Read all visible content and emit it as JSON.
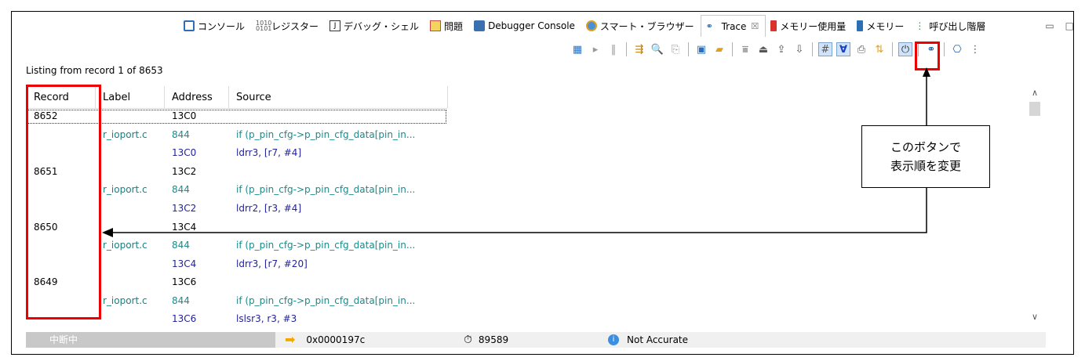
{
  "tabs": [
    {
      "label": "コンソール",
      "icon": "console-icon",
      "active": false
    },
    {
      "label": "レジスター",
      "icon": "register-icon",
      "active": false
    },
    {
      "label": "デバッグ・シェル",
      "icon": "debug-shell-icon",
      "active": false
    },
    {
      "label": "問題",
      "icon": "problems-icon",
      "active": false
    },
    {
      "label": "Debugger Console",
      "icon": "debugger-console-icon",
      "active": false
    },
    {
      "label": "スマート・ブラウザー",
      "icon": "smart-browser-icon",
      "active": false
    },
    {
      "label": "Trace",
      "icon": "trace-icon",
      "active": true,
      "close": "☒"
    },
    {
      "label": "メモリー使用量",
      "icon": "memory-usage-icon",
      "active": false
    },
    {
      "label": "メモリー",
      "icon": "memory-icon",
      "active": false
    },
    {
      "label": "呼び出し階層",
      "icon": "call-hierarchy-icon",
      "active": false
    }
  ],
  "window": {
    "minimize": "▭",
    "maximize": "□"
  },
  "listing_text": "Listing from record 1 of 8653",
  "table": {
    "headers": [
      "Record",
      "Label",
      "Address",
      "Source"
    ],
    "rows": [
      {
        "record": "8652",
        "label": "",
        "address": "13C0",
        "source": ""
      },
      {
        "record": "",
        "label": "r_ioport.c",
        "address": "844",
        "source": "if (p_pin_cfg->p_pin_cfg_data[pin_in..."
      },
      {
        "record": "",
        "label": "",
        "address": "13C0",
        "source": "ldrr3, [r7, #4]"
      },
      {
        "record": "8651",
        "label": "",
        "address": "13C2",
        "source": ""
      },
      {
        "record": "",
        "label": "r_ioport.c",
        "address": "844",
        "source": "if (p_pin_cfg->p_pin_cfg_data[pin_in..."
      },
      {
        "record": "",
        "label": "",
        "address": "13C2",
        "source": "ldrr2, [r3, #4]"
      },
      {
        "record": "8650",
        "label": "",
        "address": "13C4",
        "source": ""
      },
      {
        "record": "",
        "label": "r_ioport.c",
        "address": "844",
        "source": "if (p_pin_cfg->p_pin_cfg_data[pin_in..."
      },
      {
        "record": "",
        "label": "",
        "address": "13C4",
        "source": "ldrr3, [r7, #20]"
      },
      {
        "record": "8649",
        "label": "",
        "address": "13C6",
        "source": ""
      },
      {
        "record": "",
        "label": "r_ioport.c",
        "address": "844",
        "source": "if (p_pin_cfg->p_pin_cfg_data[pin_in..."
      },
      {
        "record": "",
        "label": "",
        "address": "13C6",
        "source": "lslsr3, r3, #3"
      }
    ]
  },
  "status": {
    "state": "中断中",
    "pc": "0x0000197c",
    "cycles": "89589",
    "accuracy": "Not Accurate"
  },
  "callout": {
    "line1": "このボタンで",
    "line2": "表示順を変更"
  },
  "colors": {
    "annotation": "#e00000",
    "teal": "#1a8a8a",
    "navy": "#23239a"
  }
}
